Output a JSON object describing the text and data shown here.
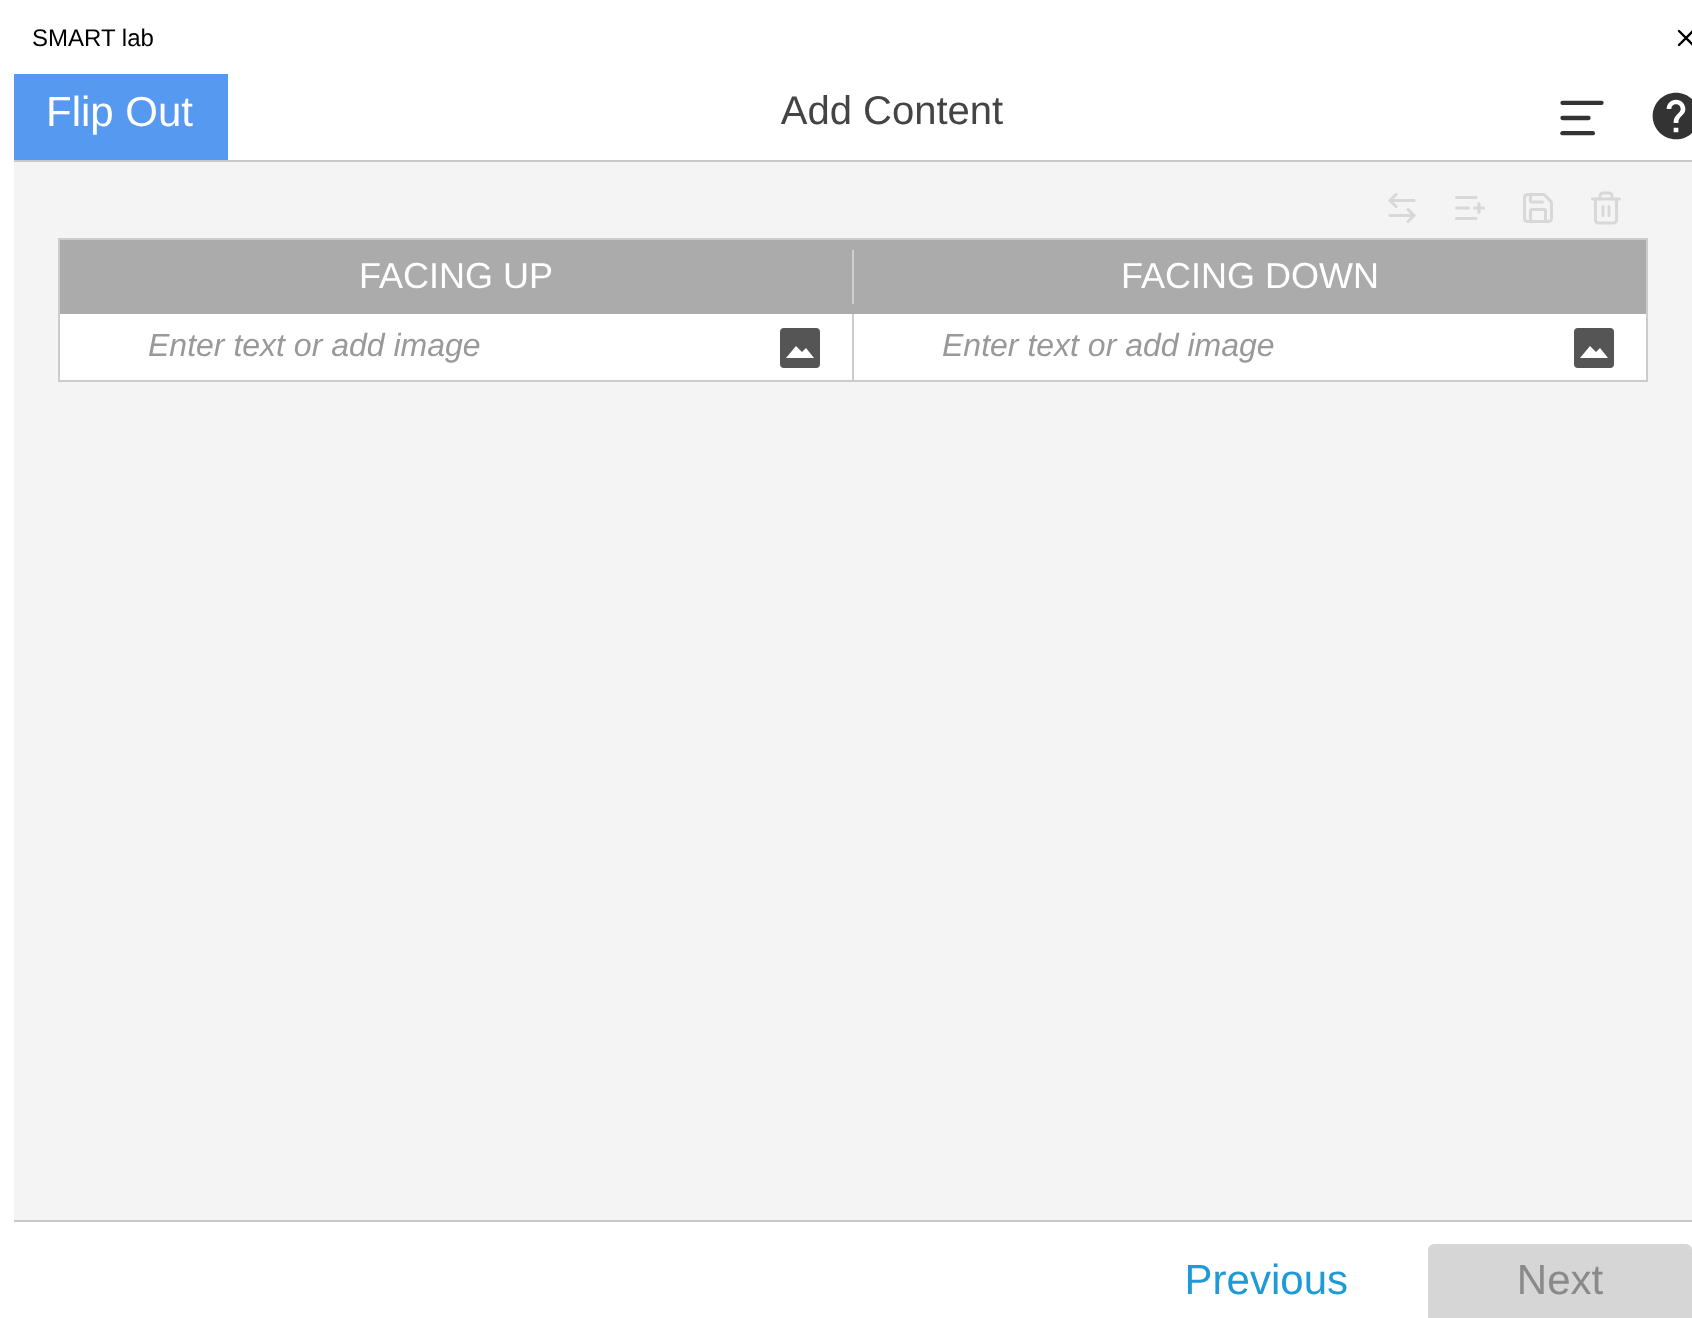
{
  "window": {
    "title": "SMART lab"
  },
  "header": {
    "tab": "Flip Out",
    "title": "Add Content"
  },
  "toolbar": [
    {
      "kind": "swap",
      "disabled": true
    },
    {
      "kind": "add-row",
      "disabled": true
    },
    {
      "kind": "save",
      "disabled": true
    },
    {
      "kind": "delete",
      "disabled": true
    }
  ],
  "table": {
    "columns": [
      "FACING UP",
      "FACING DOWN"
    ],
    "rows": [
      {
        "cells": [
          {
            "placeholder": "Enter text or add image"
          },
          {
            "placeholder": "Enter text or add image"
          }
        ]
      }
    ]
  },
  "footer": {
    "buttons": [
      {
        "label": "Previous",
        "kind": "link",
        "disabled": false
      },
      {
        "label": "Next",
        "kind": "primary",
        "disabled": true
      }
    ]
  }
}
